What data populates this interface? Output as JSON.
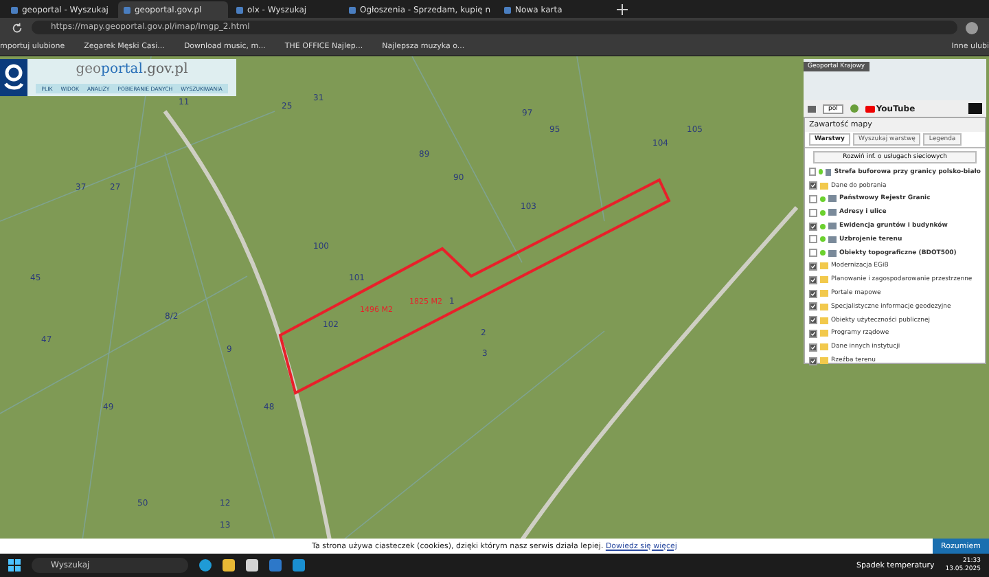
{
  "browser": {
    "tabs": [
      {
        "title": "geoportal - Wyszukaj",
        "selected": false
      },
      {
        "title": "geoportal.gov.pl",
        "selected": true
      },
      {
        "title": "olx - Wyszukaj",
        "selected": false
      },
      {
        "title": "Ogłoszenia - Sprzedam, kupię n",
        "selected": false
      },
      {
        "title": "Nowa karta",
        "selected": false
      }
    ],
    "url": "https://mapy.geoportal.gov.pl/imap/Imgp_2.html",
    "bookmarks": [
      "mportuj ulubione",
      "Zegarek Męski Casi...",
      "Download music, m...",
      "THE OFFICE Najlep...",
      "Najlepsza muzyka o..."
    ],
    "other_bookmarks": "Inne ulubi"
  },
  "geoportal": {
    "logo_left": "geo",
    "logo_mid": "portal",
    "logo_right": ".gov.pl",
    "menu": [
      "PLIK",
      "WIDOK",
      "ANALIZY",
      "POBIERANIE DANYCH",
      "WYSZUKIWANIA"
    ]
  },
  "map": {
    "parcels": [
      "27",
      "100",
      "101",
      "102",
      "103",
      "1",
      "2",
      "3",
      "48",
      "47",
      "45",
      "37",
      "25",
      "31",
      "97",
      "104",
      "89",
      "90",
      "9",
      "8/2",
      "49",
      "50",
      "12",
      "13",
      "11",
      "105",
      "95"
    ],
    "areas": [
      "1496 M2",
      "1825 M2"
    ]
  },
  "minimap": {
    "title": "Geoportal Krajowy"
  },
  "toolbar": {
    "language": "pol",
    "video": "YouTube"
  },
  "panel": {
    "title": "Zawartość mapy",
    "tabs": [
      {
        "label": "Warstwy",
        "selected": true
      },
      {
        "label": "Wyszukaj warstwę",
        "selected": false
      },
      {
        "label": "Legenda",
        "selected": false
      }
    ],
    "expand_button": "Rozwiń inf. o usługach sieciowych",
    "layers": [
      {
        "kind": "service",
        "name": "Strefa buforowa przy granicy polsko-biało",
        "checked": false
      },
      {
        "kind": "folder",
        "name": "Dane do pobrania",
        "checked": true
      },
      {
        "kind": "service",
        "name": "Państwowy Rejestr Granic",
        "checked": false
      },
      {
        "kind": "service",
        "name": "Adresy i ulice",
        "checked": false
      },
      {
        "kind": "service",
        "name": "Ewidencja gruntów i budynków",
        "checked": true
      },
      {
        "kind": "service",
        "name": "Uzbrojenie terenu",
        "checked": false
      },
      {
        "kind": "service",
        "name": "Obiekty topograficzne (BDOT500)",
        "checked": false
      },
      {
        "kind": "folder",
        "name": "Modernizacja EGiB",
        "checked": true
      },
      {
        "kind": "folder",
        "name": "Planowanie i zagospodarowanie przestrzenne",
        "checked": true
      },
      {
        "kind": "folder",
        "name": "Portale mapowe",
        "checked": true
      },
      {
        "kind": "folder",
        "name": "Specjalistyczne informacje geodezyjne",
        "checked": true
      },
      {
        "kind": "folder",
        "name": "Obiekty użyteczności publicznej",
        "checked": true
      },
      {
        "kind": "folder",
        "name": "Programy rządowe",
        "checked": true
      },
      {
        "kind": "folder",
        "name": "Dane innych instytucji",
        "checked": true
      },
      {
        "kind": "folder",
        "name": "Rzeźba terenu",
        "checked": true
      }
    ]
  },
  "cookie_bar": {
    "text": "Ta strona używa ciasteczek (cookies), dzięki którym nasz serwis działa lepiej.",
    "link": "Dowiedz się więcej",
    "button": "Rozumiem"
  },
  "taskbar": {
    "search": "Wyszukaj",
    "weather": "Spadek temperatury",
    "time": "21:33",
    "date": "13.05.2025"
  }
}
